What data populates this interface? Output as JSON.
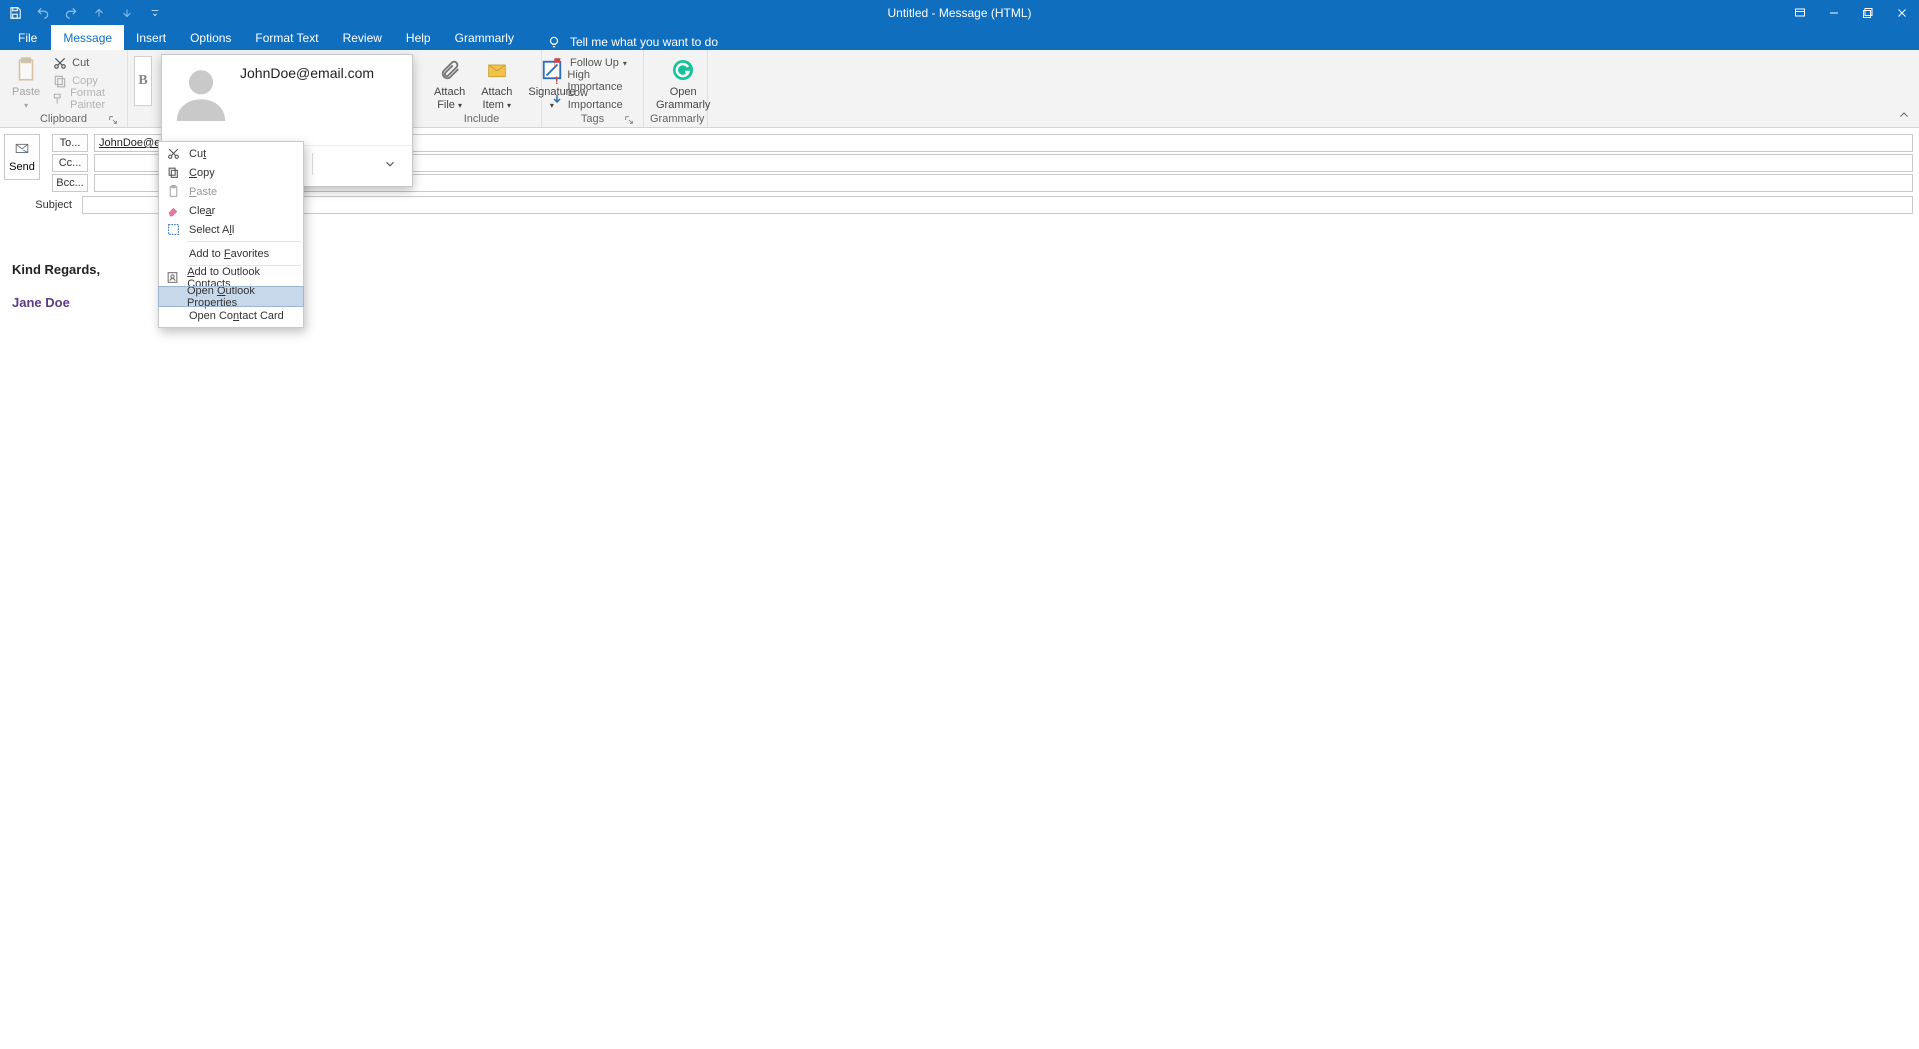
{
  "title": "Untitled  -  Message (HTML)",
  "tabs": {
    "file": "File",
    "message": "Message",
    "insert": "Insert",
    "options": "Options",
    "format_text": "Format Text",
    "review": "Review",
    "help": "Help",
    "grammarly": "Grammarly",
    "tellme": "Tell me what you want to do"
  },
  "ribbon": {
    "clipboard": {
      "paste": "Paste",
      "cut": "Cut",
      "copy": "Copy",
      "format_painter": "Format Painter",
      "label": "Clipboard"
    },
    "basic_text": {
      "b": "B"
    },
    "include": {
      "attach_file": "Attach\nFile",
      "attach_item": "Attach\nItem",
      "signature": "Signature",
      "label": "Include"
    },
    "tags": {
      "follow_up": "Follow Up",
      "high_importance": "High Importance",
      "low_importance": "Low Importance",
      "label": "Tags"
    },
    "grammarly": {
      "open": "Open\nGrammarly",
      "label": "Grammarly"
    }
  },
  "compose": {
    "send": "Send",
    "to": "To...",
    "cc": "Cc...",
    "bcc": "Bcc...",
    "subject_label": "Subject",
    "to_value": "JohnDoe@email.com"
  },
  "contact_card": {
    "name": "JohnDoe@email.com"
  },
  "context_menu": {
    "cut": "Cut",
    "copy": "Copy",
    "paste": "Paste",
    "clear": "Clear",
    "select_all": "Select All",
    "add_favorites": "Add to Favorites",
    "add_contacts": "Add to Outlook Contacts",
    "open_properties": "Open Outlook Properties",
    "open_contact_card": "Open Contact Card"
  },
  "body": {
    "sig1": "Kind Regards,",
    "sig2": "Jane Doe"
  }
}
